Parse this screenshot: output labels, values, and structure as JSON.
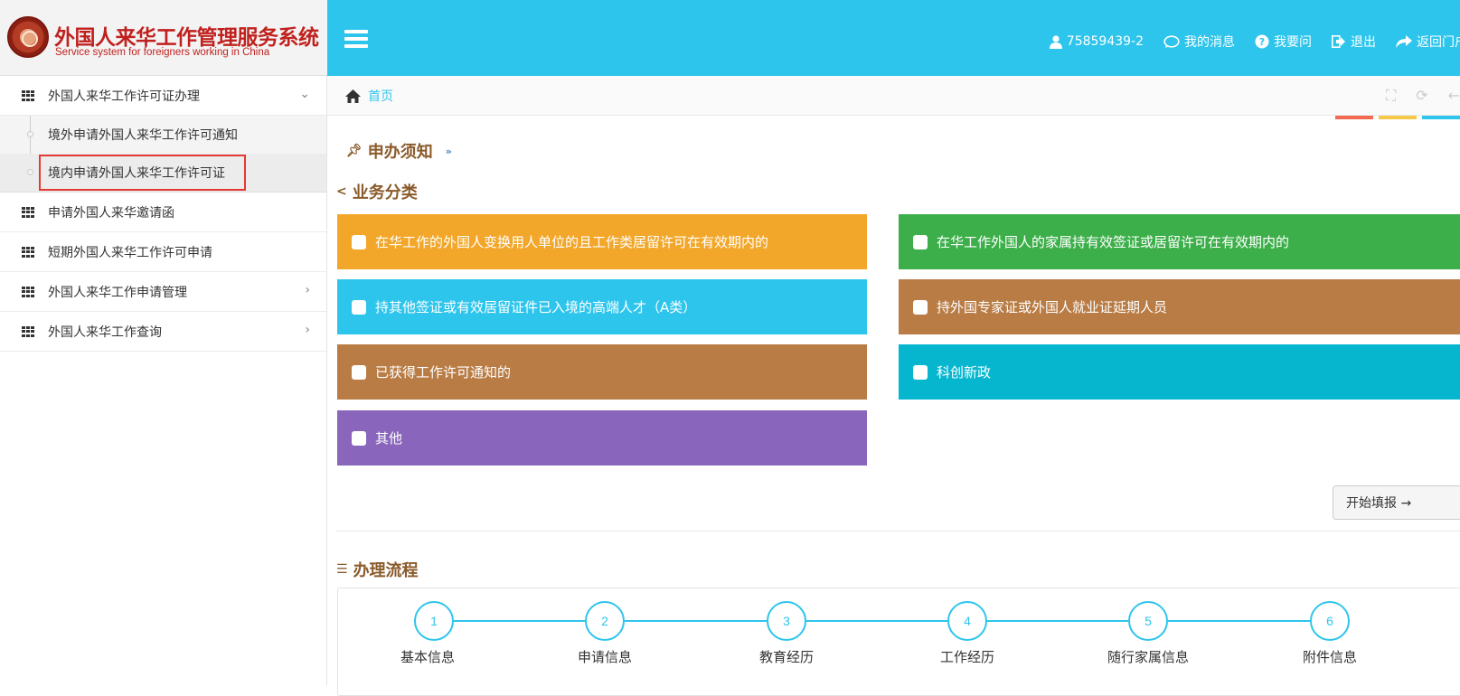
{
  "header": {
    "title": "外国人来华工作管理服务系统",
    "subtitle": "Service system for foreigners working in China",
    "nav": {
      "user": "75859439-2",
      "messages": "我的消息",
      "ask": "我要问",
      "logout": "退出",
      "return_portal": "返回门户"
    }
  },
  "sidebar": {
    "group1": {
      "label": "外国人来华工作许可证办理",
      "caret": "⌄",
      "sub": [
        "境外申请外国人来华工作许可通知",
        "境内申请外国人来华工作许可证"
      ]
    },
    "items": [
      {
        "label": "申请外国人来华邀请函",
        "caret": ""
      },
      {
        "label": "短期外国人来华工作许可申请",
        "caret": ""
      },
      {
        "label": "外国人来华工作申请管理",
        "caret": "›"
      },
      {
        "label": "外国人来华工作查询",
        "caret": "›"
      }
    ]
  },
  "breadcrumb": {
    "home": "首页"
  },
  "notice": {
    "title": "申办须知",
    "expand": "»"
  },
  "business": {
    "title": "业务分类",
    "categories": [
      {
        "label": "在华工作的外国人变换用人单位的且工作类居留许可在有效期内的",
        "color": "#f2a72a"
      },
      {
        "label": "在华工作外国人的家属持有效签证或居留许可在有效期内的",
        "color": "#3daf4a"
      },
      {
        "label": "持其他签证或有效居留证件已入境的高端人才（A类）",
        "color": "#2ec5ec"
      },
      {
        "label": "持外国专家证或外国人就业证延期人员",
        "color": "#b97c45"
      },
      {
        "label": "已获得工作许可通知的",
        "color": "#b97c45"
      },
      {
        "label": "科创新政",
        "color": "#06b6cf"
      },
      {
        "label": "其他",
        "color": "#8966bb"
      }
    ],
    "start_button": "开始填报 →"
  },
  "process": {
    "title": "办理流程",
    "steps": [
      {
        "num": "1",
        "label": "基本信息"
      },
      {
        "num": "2",
        "label": "申请信息"
      },
      {
        "num": "3",
        "label": "教育经历"
      },
      {
        "num": "4",
        "label": "工作经历"
      },
      {
        "num": "5",
        "label": "随行家属信息"
      },
      {
        "num": "6",
        "label": "附件信息"
      }
    ]
  },
  "colors": {
    "header": "#2ec5ec",
    "strip1": "#f26a52",
    "strip2": "#f7c94b",
    "strip3": "#2ec5ec"
  }
}
